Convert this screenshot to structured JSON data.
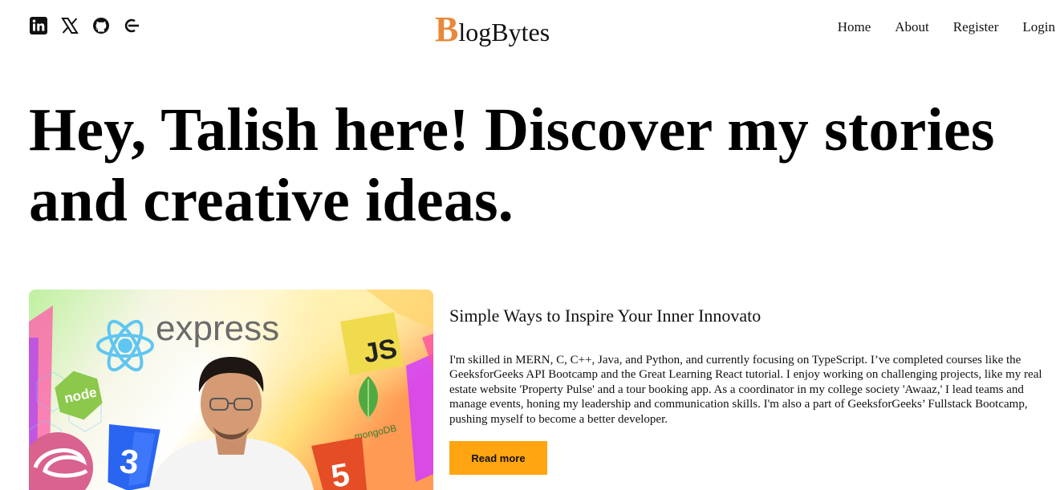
{
  "header": {
    "social": [
      {
        "icon": "linkedin-icon"
      },
      {
        "icon": "x-twitter-icon"
      },
      {
        "icon": "github-icon"
      },
      {
        "icon": "geeksforgeeks-icon"
      }
    ],
    "logo_initial": "B",
    "logo_rest": "logBytes",
    "nav": [
      "Home",
      "About",
      "Register",
      "Login"
    ]
  },
  "hero": {
    "line1": "Hey, Talish here! Discover my stories",
    "line2": "and creative ideas."
  },
  "featured_post": {
    "image_labels": {
      "express": "express",
      "js": "JS",
      "node": "node",
      "mongo": "mongoDB",
      "css": "3",
      "html": "5"
    },
    "title": "Simple Ways to Inspire Your Inner Innovato",
    "body": "I'm skilled in MERN, C, C++, Java, and Python, and currently focusing on TypeScript. I’ve completed courses like the GeeksforGeeks API Bootcamp and the Great Learning React tutorial. I enjoy working on challenging projects, like my real estate website 'Property Pulse' and a tour booking app. As a coordinator in my college society 'Awaaz,' I lead teams and manage events, honing my leadership and communication skills. I'm also a part of GeeksforGeeks’ Fullstack Bootcamp, pushing myself to become a better developer.",
    "button_label": "Read more"
  },
  "colors": {
    "accent": "#ffa512",
    "logo": "#e8883a"
  }
}
